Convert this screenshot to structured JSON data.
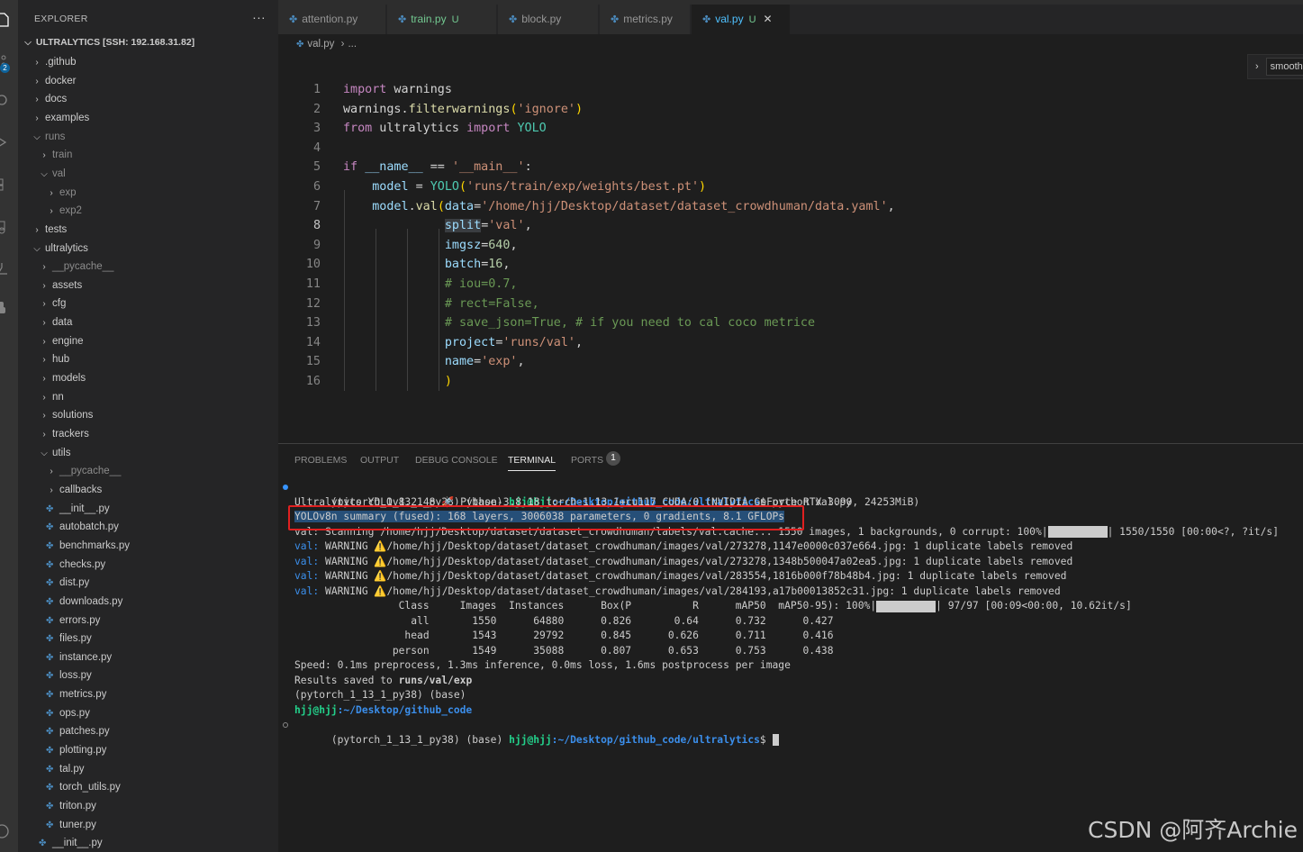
{
  "sidebar": {
    "title": "EXPLORER",
    "more": "···",
    "root": "ULTRALYTICS [SSH: 192.168.31.82]",
    "items": [
      {
        "label": ".github",
        "type": "folder",
        "open": false
      },
      {
        "label": "docker",
        "type": "folder",
        "open": false
      },
      {
        "label": "docs",
        "type": "folder",
        "open": false
      },
      {
        "label": "examples",
        "type": "folder",
        "open": false
      },
      {
        "label": "runs",
        "type": "folder",
        "open": true,
        "dim": true
      },
      {
        "label": "train",
        "type": "folder",
        "open": false,
        "dim": true
      },
      {
        "label": "val",
        "type": "folder",
        "open": true,
        "dim": true
      },
      {
        "label": "exp",
        "type": "folder",
        "open": false,
        "dim": true
      },
      {
        "label": "exp2",
        "type": "folder",
        "open": false,
        "dim": true
      },
      {
        "label": "tests",
        "type": "folder",
        "open": false
      },
      {
        "label": "ultralytics",
        "type": "folder",
        "open": true
      },
      {
        "label": "__pycache__",
        "type": "folder",
        "open": false,
        "dim": true
      },
      {
        "label": "assets",
        "type": "folder",
        "open": false
      },
      {
        "label": "cfg",
        "type": "folder",
        "open": false
      },
      {
        "label": "data",
        "type": "folder",
        "open": false
      },
      {
        "label": "engine",
        "type": "folder",
        "open": false
      },
      {
        "label": "hub",
        "type": "folder",
        "open": false
      },
      {
        "label": "models",
        "type": "folder",
        "open": false
      },
      {
        "label": "nn",
        "type": "folder",
        "open": false
      },
      {
        "label": "solutions",
        "type": "folder",
        "open": false
      },
      {
        "label": "trackers",
        "type": "folder",
        "open": false
      },
      {
        "label": "utils",
        "type": "folder",
        "open": true
      },
      {
        "label": "__pycache__",
        "type": "folder",
        "open": false,
        "dim": true
      },
      {
        "label": "callbacks",
        "type": "folder",
        "open": false
      },
      {
        "label": "__init__.py",
        "type": "file"
      },
      {
        "label": "autobatch.py",
        "type": "file"
      },
      {
        "label": "benchmarks.py",
        "type": "file"
      },
      {
        "label": "checks.py",
        "type": "file"
      },
      {
        "label": "dist.py",
        "type": "file"
      },
      {
        "label": "downloads.py",
        "type": "file"
      },
      {
        "label": "errors.py",
        "type": "file"
      },
      {
        "label": "files.py",
        "type": "file"
      },
      {
        "label": "instance.py",
        "type": "file"
      },
      {
        "label": "loss.py",
        "type": "file"
      },
      {
        "label": "metrics.py",
        "type": "file"
      },
      {
        "label": "ops.py",
        "type": "file"
      },
      {
        "label": "patches.py",
        "type": "file"
      },
      {
        "label": "plotting.py",
        "type": "file"
      },
      {
        "label": "tal.py",
        "type": "file"
      },
      {
        "label": "torch_utils.py",
        "type": "file"
      },
      {
        "label": "triton.py",
        "type": "file"
      },
      {
        "label": "tuner.py",
        "type": "file"
      },
      {
        "label": "__init__.py",
        "type": "file"
      }
    ]
  },
  "tabs": [
    {
      "label": "attention.py",
      "modified": "",
      "active": false
    },
    {
      "label": "train.py",
      "modified": "U",
      "active": false
    },
    {
      "label": "block.py",
      "modified": "",
      "active": false
    },
    {
      "label": "metrics.py",
      "modified": "",
      "active": false
    },
    {
      "label": "val.py",
      "modified": "U",
      "active": true
    }
  ],
  "breadcrumb": {
    "file": "val.py",
    "rest": "..."
  },
  "minimap": {
    "label": "smooth"
  },
  "editor": {
    "current_line": 8,
    "lines": [
      "1",
      "2",
      "3",
      "4",
      "5",
      "6",
      "7",
      "8",
      "9",
      "10",
      "11",
      "12",
      "13",
      "14",
      "15",
      "16"
    ]
  },
  "panel": {
    "tabs": [
      "PROBLEMS",
      "OUTPUT",
      "DEBUG CONSOLE",
      "TERMINAL",
      "PORTS"
    ],
    "active_tab": "TERMINAL",
    "ports_count": "1"
  },
  "terminal": {
    "prompt_env": "(pytorch_1_13_1_py38) (base) ",
    "user_host": "hjj@hjj",
    "cwd": ":~/Desktop/github_code/ultralytics",
    "cmd": "$ python val.py",
    "version_line": "Ultralytics YOLOv8.2.48 🚀 Python-3.8.18 torch-1.13.1+cu117 CUDA:0 (NVIDIA GeForce RTX 3090, 24253MiB)",
    "summary_line": "YOLOv8n summary (fused): 168 layers, 3006038 parameters, 0 gradients, 8.1 GFLOPs",
    "scan_prefix": "val: Scanning /home/hjj/Desktop/dataset/dataset_crowdhuman/labels/val.cache... 1550 images, 1 backgrounds, 0 corrupt: 100%|",
    "scan_suffix": "| 1550/1550 [00:00<?, ?it/s]",
    "warnings": [
      "/home/hjj/Desktop/dataset/dataset_crowdhuman/images/val/273278,1147e0000c037e664.jpg: 1 duplicate labels removed",
      "/home/hjj/Desktop/dataset/dataset_crowdhuman/images/val/273278,1348b500047a02ea5.jpg: 1 duplicate labels removed",
      "/home/hjj/Desktop/dataset/dataset_crowdhuman/images/val/283554,1816b000f78b48b4.jpg: 1 duplicate labels removed",
      "/home/hjj/Desktop/dataset/dataset_crowdhuman/images/val/284193,a17b00013852c31.jpg: 1 duplicate labels removed"
    ],
    "val_tag": "val:",
    "warning_word": " WARNING ⚠️",
    "table_header": "                 Class     Images  Instances      Box(P          R      mAP50  mAP50-95): 100%|",
    "table_header_suffix": "| 97/97 [00:09<00:00, 10.62it/s]",
    "table_rows": [
      "                   all       1550      64880      0.826       0.64      0.732      0.427",
      "                  head       1543      29792      0.845      0.626      0.711      0.416",
      "                person       1549      35088      0.807      0.653      0.753      0.438"
    ],
    "speed_line": "Speed: 0.1ms preprocess, 1.3ms inference, 0.0ms loss, 1.6ms postprocess per image",
    "results_prefix": "Results saved to ",
    "results_path": "runs/val/exp",
    "env_line": "(pytorch_1_13_1_py38) (base)",
    "short_cwd": ":~/Desktop/github_code",
    "final_cwd": ":~/Desktop/github_code/ultralytics",
    "final_prompt": "$ "
  },
  "watermark": "CSDN @阿齐Archie",
  "colors": {
    "accent": "#4fc1ff",
    "highlight_box": "#e02020",
    "selection": "#264f78"
  }
}
